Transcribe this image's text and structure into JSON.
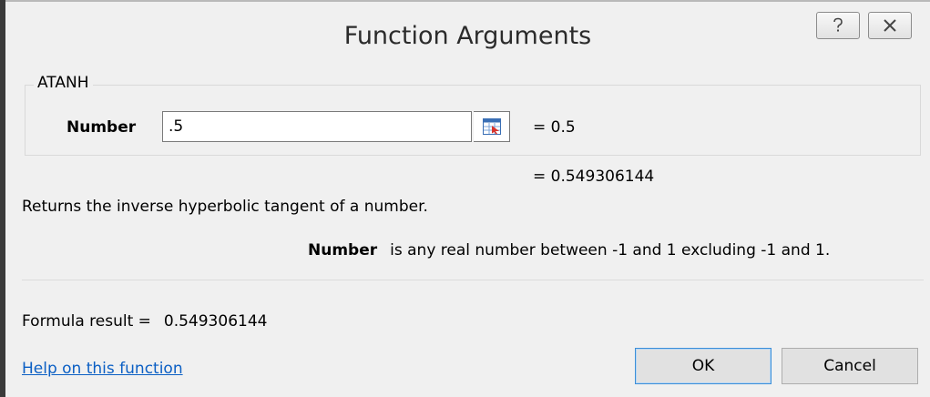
{
  "window": {
    "title": "Function Arguments",
    "help_icon": "question-mark-icon",
    "close_icon": "close-icon"
  },
  "function": {
    "name": "ATANH",
    "argument_label": "Number",
    "argument_value": ".5",
    "argument_equals": "=  0.5",
    "result_equals": "=  0.549306144",
    "reference_icon": "collapse-dialog-icon"
  },
  "description": {
    "function_text": "Returns the inverse hyperbolic tangent of a number.",
    "argument_name": "Number",
    "argument_text": "is any real number between -1 and 1 excluding -1 and 1."
  },
  "formula_result": {
    "label": "Formula result =",
    "value": "0.549306144"
  },
  "footer": {
    "help_link": "Help on this function",
    "ok_label": "OK",
    "cancel_label": "Cancel"
  },
  "colors": {
    "dialog_bg": "#f0f0f0",
    "link": "#0b5fc4",
    "ok_focus_border": "#3c8fd8"
  }
}
